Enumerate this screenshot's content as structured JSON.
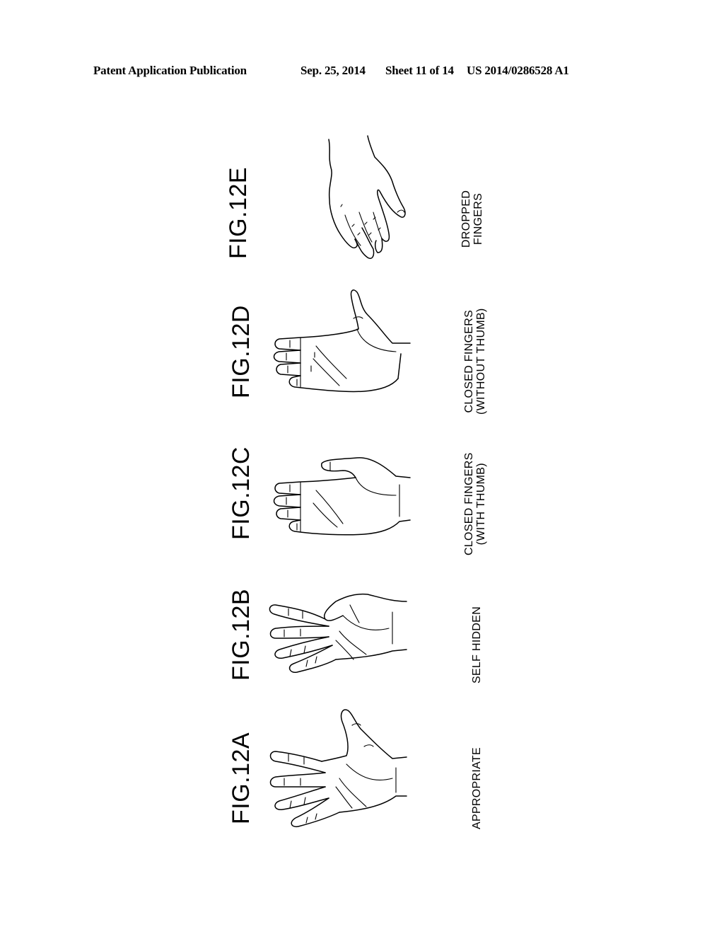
{
  "header": {
    "publication": "Patent Application Publication",
    "date": "Sep. 25, 2014",
    "sheet": "Sheet 11 of 14",
    "number": "US 2014/0286528 A1"
  },
  "figures": [
    {
      "id": "12A",
      "label": "FIG.12A",
      "caption": [
        "APPROPRIATE"
      ]
    },
    {
      "id": "12B",
      "label": "FIG.12B",
      "caption": [
        "SELF HIDDEN"
      ]
    },
    {
      "id": "12C",
      "label": "FIG.12C",
      "caption": [
        "CLOSED FINGERS",
        "(WITH THUMB)"
      ]
    },
    {
      "id": "12D",
      "label": "FIG.12D",
      "caption": [
        "CLOSED FINGERS",
        "(WITHOUT THUMB)"
      ]
    },
    {
      "id": "12E",
      "label": "FIG.12E",
      "caption": [
        "DROPPED",
        "FINGERS"
      ]
    }
  ]
}
